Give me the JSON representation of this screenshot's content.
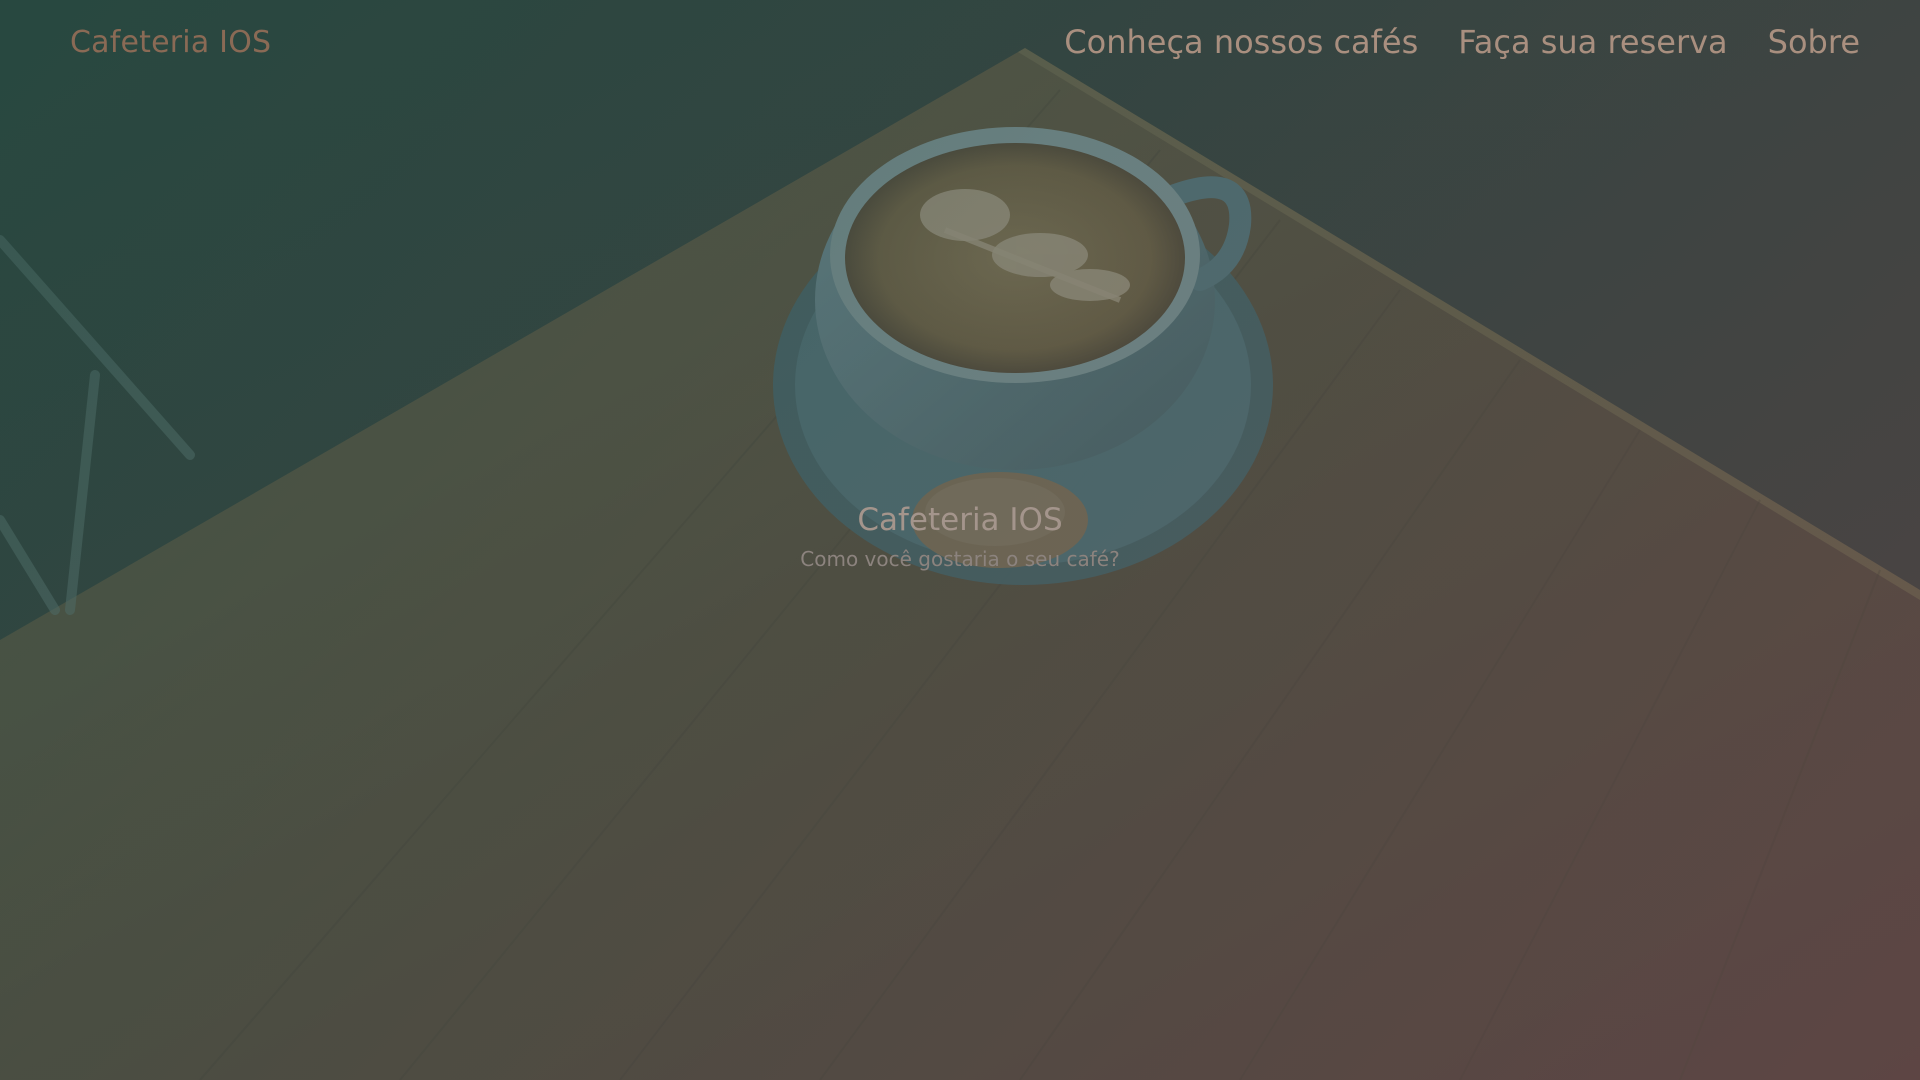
{
  "navbar": {
    "brand": "Cafeteria IOS",
    "links": [
      {
        "label": "Conheça nossos cafés"
      },
      {
        "label": "Faça sua reserva"
      },
      {
        "label": "Sobre"
      }
    ]
  },
  "hero": {
    "title": "Cafeteria IOS",
    "subtitle": "Como você gostaria o seu café?",
    "background_image": "coffee-cup-on-wooden-table"
  },
  "colors": {
    "brand_text": "#8a6a55",
    "nav_text": "#a98f7f",
    "overlay_start": "#1e463c",
    "overlay_end": "#5f3c3c"
  }
}
